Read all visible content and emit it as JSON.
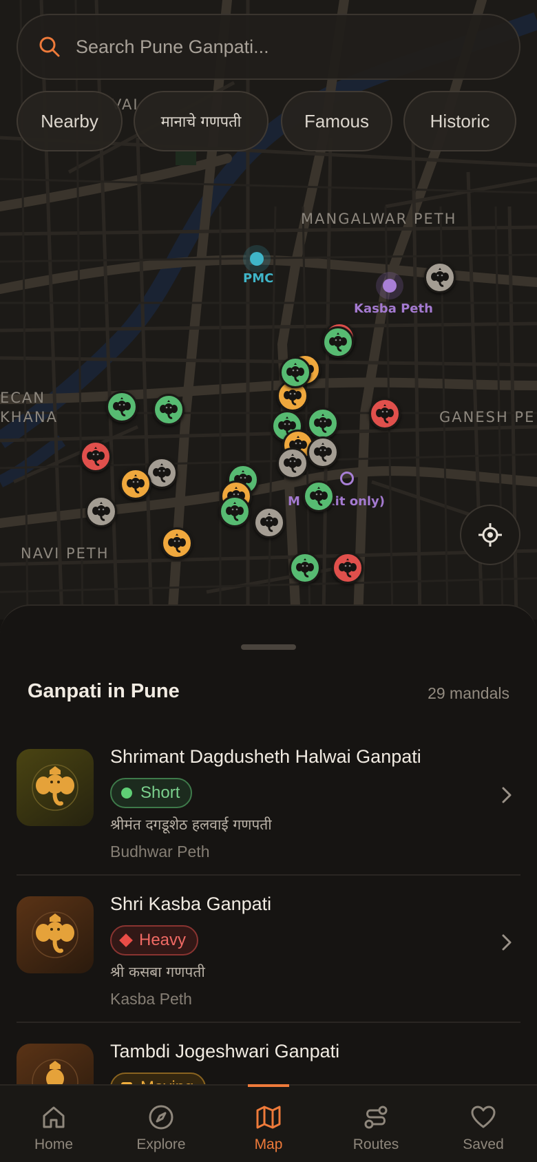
{
  "search": {
    "placeholder": "Search Pune Ganpati..."
  },
  "chips": [
    {
      "label": "Nearby"
    },
    {
      "label": "मानाचे गणपती"
    },
    {
      "label": "Famous"
    },
    {
      "label": "Historic"
    }
  ],
  "map": {
    "area_labels": [
      "MANGALWAR PETH",
      "ECAN",
      "KHANA",
      "GANESH PE",
      "NAVI PETH",
      "VAI"
    ],
    "poi_labels": {
      "pmc": "PMC",
      "kasba": "Kasba Peth",
      "exit": "M    i (exit only)"
    },
    "marker_colors": {
      "green": "#57bb72",
      "red": "#e0504c",
      "gray": "#a49d93",
      "orange": "#f0a83d"
    }
  },
  "sheet": {
    "title": "Ganpati in Pune",
    "count": "29 mandals",
    "items": [
      {
        "name": "Shrimant Dagdusheth Halwai Ganpati",
        "status": "Short",
        "marathi": "श्रीमंत दगडूशेठ हलवाई गणपती",
        "area": "Budhwar Peth"
      },
      {
        "name": "Shri Kasba Ganpati",
        "status": "Heavy",
        "marathi": "श्री कसबा गणपती",
        "area": "Kasba Peth"
      },
      {
        "name": "Tambdi Jogeshwari Ganpati",
        "status": "Moving",
        "marathi": "",
        "area": ""
      }
    ]
  },
  "nav": [
    {
      "label": "Home",
      "icon": "home-icon"
    },
    {
      "label": "Explore",
      "icon": "compass-icon"
    },
    {
      "label": "Map",
      "icon": "map-icon",
      "active": true
    },
    {
      "label": "Routes",
      "icon": "routes-icon"
    },
    {
      "label": "Saved",
      "icon": "heart-icon"
    }
  ],
  "colors": {
    "accent": "#ee7a3a",
    "background": "#151311"
  }
}
